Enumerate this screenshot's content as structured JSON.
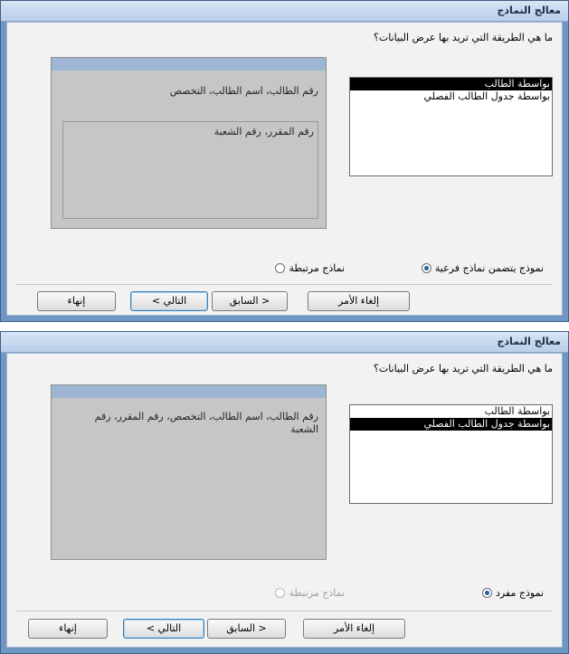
{
  "window1": {
    "title": "معالج النماذج",
    "question": "ما هي الطريقة التي تريد بها عرض البيانات؟",
    "list_items": [
      {
        "label": "بواسطة الطالب",
        "selected": true
      },
      {
        "label": "بواسطة جدول الطالب الفصلي",
        "selected": false
      }
    ],
    "preview_main": "رقم الطالب، اسم الطالب، التخصص",
    "preview_sub": "رقم المقرر، رقم الشعبة",
    "radio_main": "نموذج يتضمن نماذج فرعية",
    "radio_linked": "نماذج مرتبطة",
    "buttons": {
      "cancel": "إلغاء الأمر",
      "back": "< السابق",
      "next": "التالي >",
      "finish": "إنهاء"
    }
  },
  "window2": {
    "title": "معالج النماذج",
    "question": "ما هي الطريقة التي تريد بها عرض البيانات؟",
    "list_items": [
      {
        "label": "بواسطة الطالب",
        "selected": false
      },
      {
        "label": "بواسطة جدول الطالب الفصلي",
        "selected": true
      }
    ],
    "preview_main": "رقم الطالب، اسم الطالب، التخصص، رقم المقرر، رقم الشعبة",
    "radio_main": "نموذج مفرد",
    "radio_linked": "نماذج مرتبطة",
    "buttons": {
      "cancel": "إلغاء الأمر",
      "back": "< السابق",
      "next": "التالي >",
      "finish": "إنهاء"
    }
  }
}
